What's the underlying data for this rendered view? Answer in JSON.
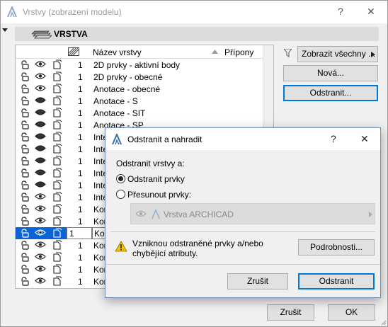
{
  "window": {
    "title": "Vrstvy (zobrazení modelu)",
    "help_glyph": "?",
    "close_glyph": "✕"
  },
  "section": {
    "label": "VRSTVA"
  },
  "table": {
    "col_name": "Název vrstvy",
    "col_ext": "Přípony",
    "rows": [
      {
        "num": "1",
        "name": "2D prvky - aktivní body",
        "lock": "open",
        "eye": "open",
        "selected": false
      },
      {
        "num": "1",
        "name": "2D prvky - obecné",
        "lock": "open",
        "eye": "open",
        "selected": false
      },
      {
        "num": "1",
        "name": "Anotace - obecné",
        "lock": "open",
        "eye": "open",
        "selected": false
      },
      {
        "num": "1",
        "name": "Anotace - S",
        "lock": "open",
        "eye": "closed",
        "selected": false
      },
      {
        "num": "1",
        "name": "Anotace - SIT",
        "lock": "open",
        "eye": "closed",
        "selected": false
      },
      {
        "num": "1",
        "name": "Anotace - SP",
        "lock": "open",
        "eye": "closed",
        "selected": false
      },
      {
        "num": "1",
        "name": "Inte",
        "lock": "open",
        "eye": "closed",
        "selected": false
      },
      {
        "num": "1",
        "name": "Inte",
        "lock": "open",
        "eye": "closed",
        "selected": false
      },
      {
        "num": "1",
        "name": "Inte",
        "lock": "open",
        "eye": "closed",
        "selected": false
      },
      {
        "num": "1",
        "name": "Inte",
        "lock": "open",
        "eye": "closed",
        "selected": false
      },
      {
        "num": "1",
        "name": "Inte",
        "lock": "open",
        "eye": "closed",
        "selected": false
      },
      {
        "num": "1",
        "name": "Inte",
        "lock": "open",
        "eye": "open",
        "selected": false
      },
      {
        "num": "1",
        "name": "Kon",
        "lock": "open",
        "eye": "open",
        "selected": false
      },
      {
        "num": "1",
        "name": "Kon",
        "lock": "open",
        "eye": "open",
        "selected": false
      },
      {
        "num": "1",
        "name": "Kon",
        "lock": "open",
        "eye": "open",
        "selected": true
      },
      {
        "num": "1",
        "name": "Kon",
        "lock": "open",
        "eye": "open",
        "selected": false
      },
      {
        "num": "1",
        "name": "Kon",
        "lock": "open",
        "eye": "open",
        "selected": false
      },
      {
        "num": "1",
        "name": "Kon",
        "lock": "open",
        "eye": "open",
        "selected": false
      },
      {
        "num": "1",
        "name": "Kon",
        "lock": "open",
        "eye": "open",
        "selected": false
      }
    ]
  },
  "right_panel": {
    "filter_label": "Zobrazit všechny ...",
    "new_label": "Nová...",
    "delete_label": "Odstranit..."
  },
  "footer": {
    "cancel_label": "Zrušit",
    "ok_label": "OK"
  },
  "dialog": {
    "title": "Odstranit a nahradit",
    "help_glyph": "?",
    "close_glyph": "✕",
    "prompt": "Odstranit vrstvy a:",
    "option_delete": "Odstranit prvky",
    "option_move": "Přesunout prvky:",
    "selected_option": "delete",
    "combo_value": "Vrstva ARCHICAD",
    "warning": "Vzniknou odstraněné prvky a/nebo chybějící atributy.",
    "details_label": "Podrobnosti...",
    "cancel_label": "Zrušit",
    "confirm_label": "Odstranit"
  }
}
